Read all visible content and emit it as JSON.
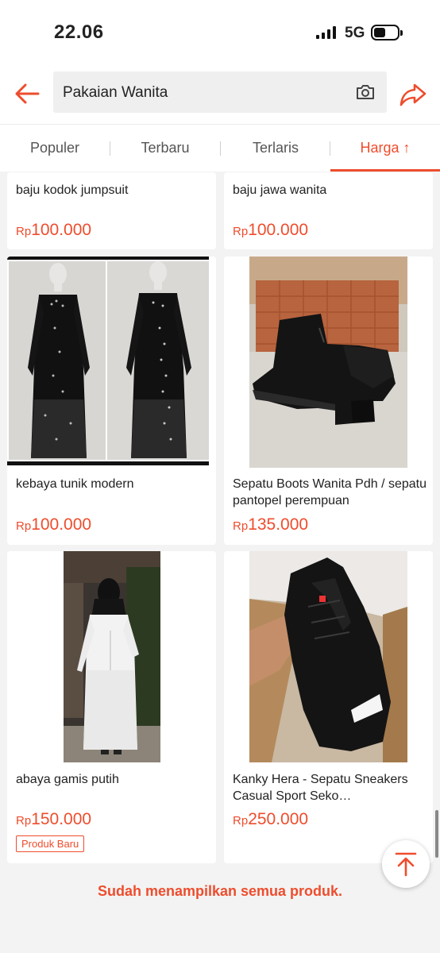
{
  "status_bar": {
    "time": "22.06",
    "network": "5G"
  },
  "header": {
    "search_value": "Pakaian Wanita"
  },
  "sort_tabs": [
    {
      "label": "Populer",
      "active": false
    },
    {
      "label": "Terbaru",
      "active": false
    },
    {
      "label": "Terlaris",
      "active": false
    },
    {
      "label": "Harga ↑",
      "active": true
    }
  ],
  "products": [
    {
      "name": "baju kodok jumpsuit",
      "currency": "Rp",
      "price": "100.000"
    },
    {
      "name": "baju jawa wanita",
      "currency": "Rp",
      "price": "100.000"
    },
    {
      "name": "kebaya tunik modern",
      "currency": "Rp",
      "price": "100.000"
    },
    {
      "name": "Sepatu Boots Wanita Pdh / sepatu pantopel perempuan",
      "currency": "Rp",
      "price": "135.000"
    },
    {
      "name": "abaya gamis putih",
      "currency": "Rp",
      "price": "150.000",
      "badge": "Produk Baru"
    },
    {
      "name": "Kanky Hera - Sepatu Sneakers Casual Sport Seko…",
      "currency": "Rp",
      "price": "250.000"
    }
  ],
  "footer": {
    "end_message": "Sudah menampilkan semua produk."
  },
  "colors": {
    "accent": "#ee4d2d",
    "background": "#f3f3f3"
  },
  "icons": [
    "back-arrow-icon",
    "camera-icon",
    "share-icon",
    "scroll-to-top-icon"
  ]
}
